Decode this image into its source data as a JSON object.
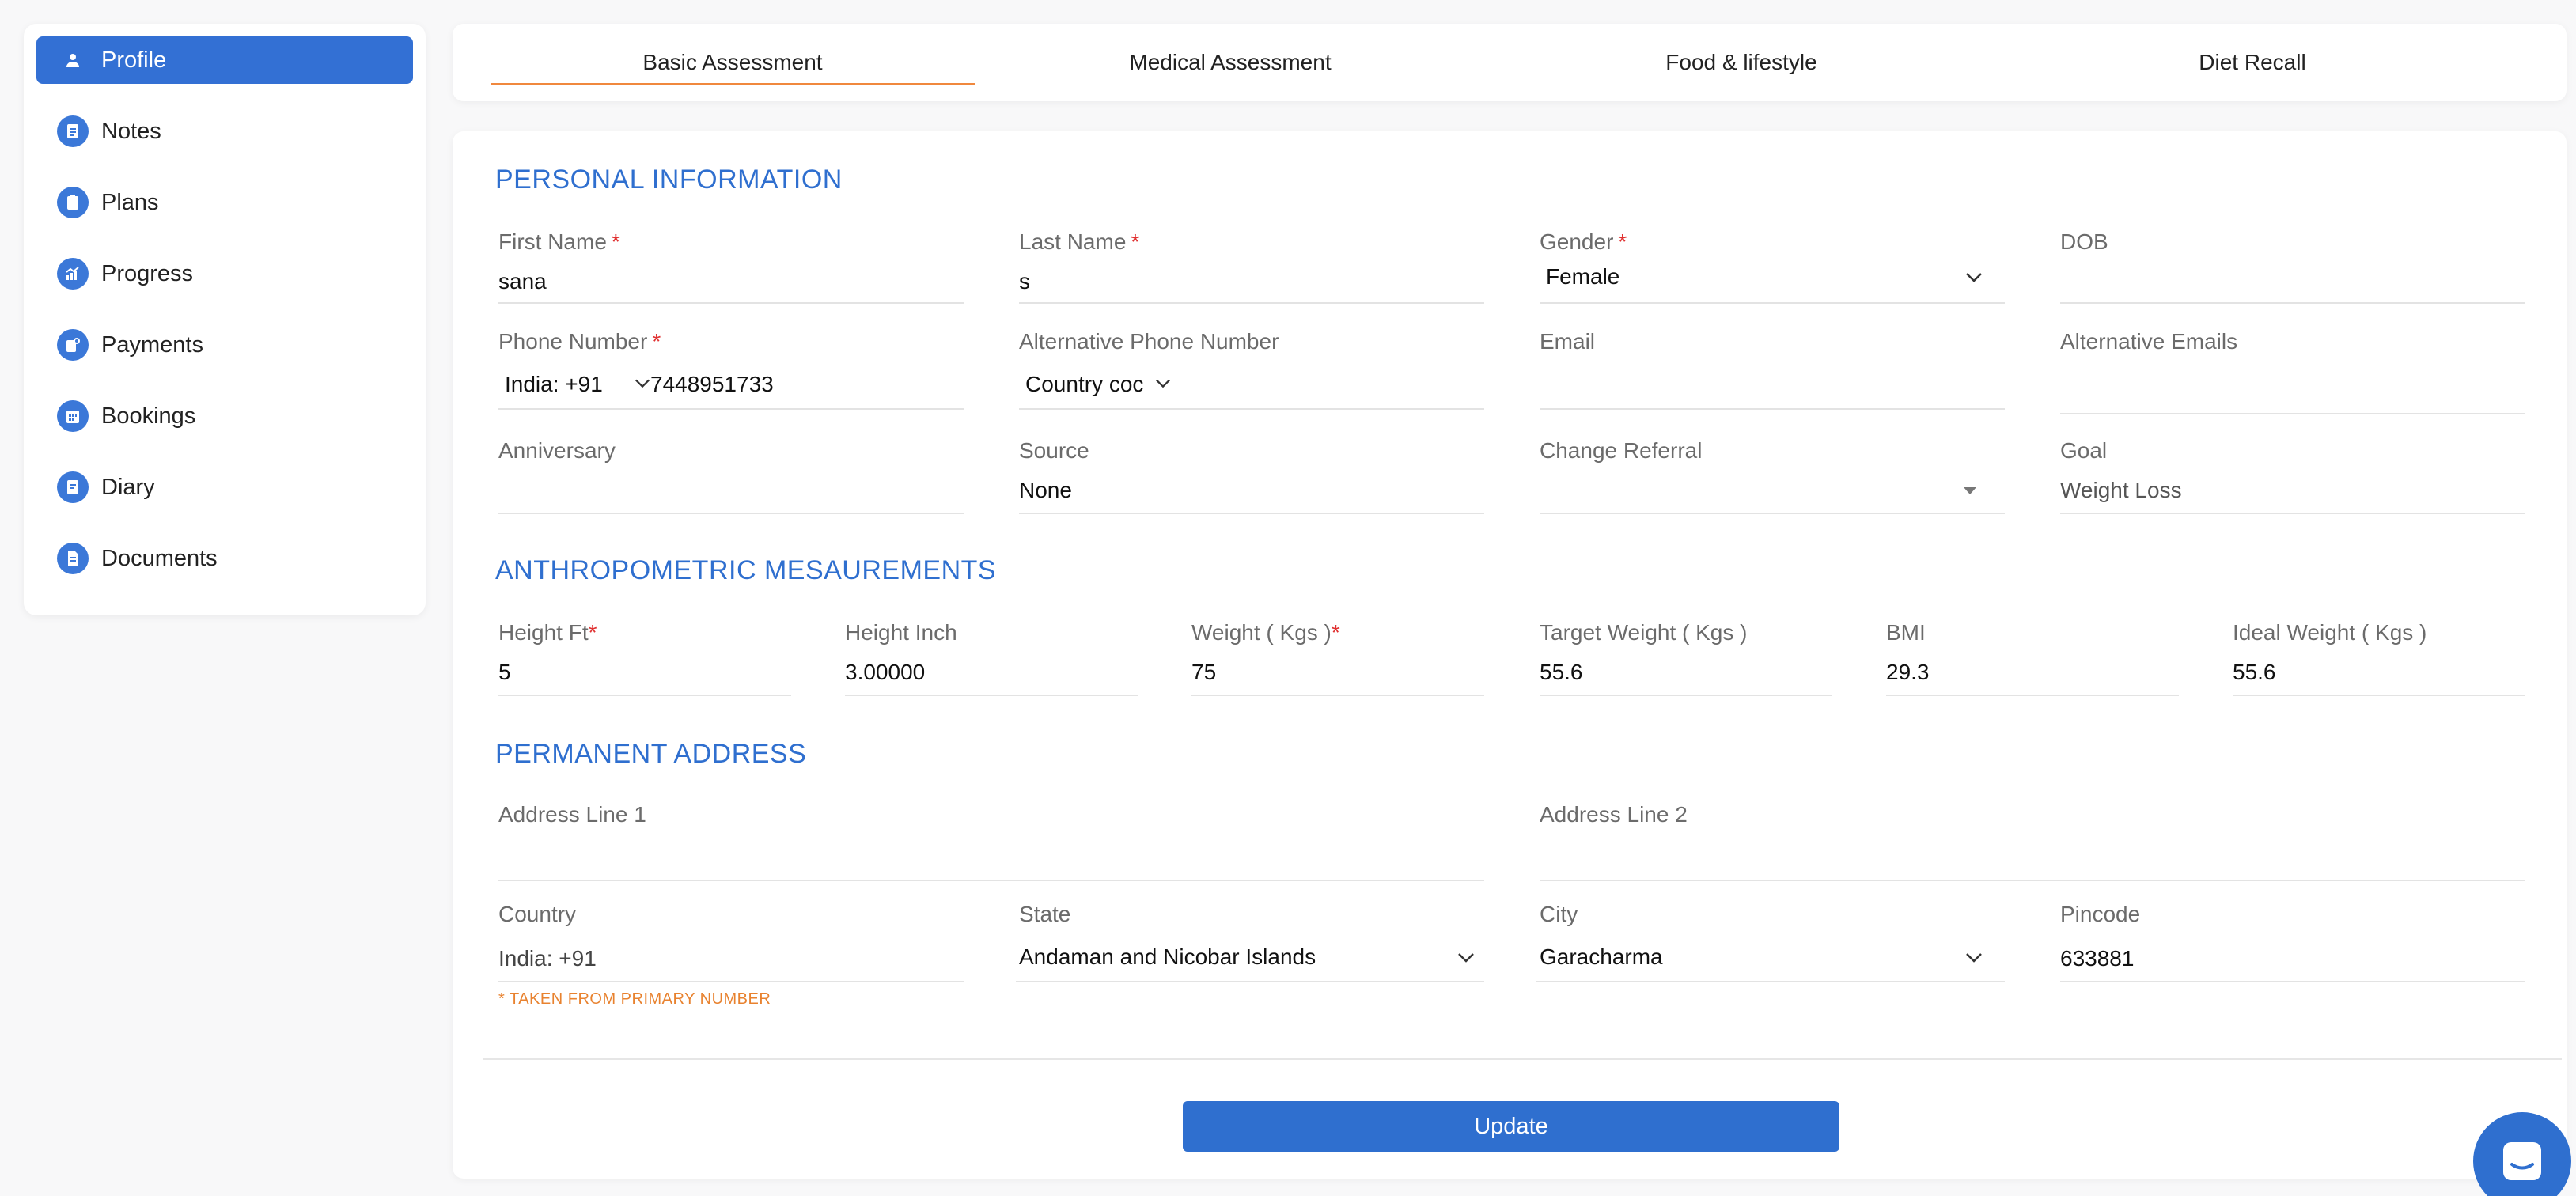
{
  "sidebar": {
    "items": [
      {
        "label": "Profile",
        "icon": "user-icon",
        "active": true
      },
      {
        "label": "Notes",
        "icon": "notes-icon"
      },
      {
        "label": "Plans",
        "icon": "plans-icon"
      },
      {
        "label": "Progress",
        "icon": "progress-icon"
      },
      {
        "label": "Payments",
        "icon": "payments-icon"
      },
      {
        "label": "Bookings",
        "icon": "bookings-icon"
      },
      {
        "label": "Diary",
        "icon": "diary-icon"
      },
      {
        "label": "Documents",
        "icon": "documents-icon"
      }
    ]
  },
  "tabs": [
    {
      "label": "Basic Assessment",
      "active": true
    },
    {
      "label": "Medical Assessment"
    },
    {
      "label": "Food & lifestyle"
    },
    {
      "label": "Diet Recall"
    }
  ],
  "personal": {
    "title": "PERSONAL INFORMATION",
    "first_name": {
      "label": "First Name",
      "value": "sana"
    },
    "last_name": {
      "label": "Last Name",
      "value": "s"
    },
    "gender": {
      "label": "Gender",
      "value": "Female"
    },
    "dob": {
      "label": "DOB",
      "value": ""
    },
    "phone": {
      "label": "Phone Number",
      "code": "India: +91",
      "value": "7448951733"
    },
    "alt_phone": {
      "label": "Alternative Phone Number",
      "code": "Country coc"
    },
    "email": {
      "label": "Email",
      "value": ""
    },
    "alt_emails": {
      "label": "Alternative Emails",
      "value": ""
    },
    "anniversary": {
      "label": "Anniversary",
      "value": ""
    },
    "source": {
      "label": "Source",
      "value": "None"
    },
    "referral": {
      "label": "Change Referral",
      "value": ""
    },
    "goal": {
      "label": "Goal",
      "value": "Weight Loss"
    }
  },
  "anthro": {
    "title": "ANTHROPOMETRIC MESAUREMENTS",
    "height_ft": {
      "label": "Height Ft",
      "value": "5"
    },
    "height_inch": {
      "label": "Height Inch",
      "value": "3.00000"
    },
    "weight": {
      "label": "Weight ( Kgs )",
      "value": "75"
    },
    "target_weight": {
      "label": "Target Weight ( Kgs )",
      "value": "55.6"
    },
    "bmi": {
      "label": "BMI",
      "value": "29.3"
    },
    "ideal_weight": {
      "label": "Ideal Weight ( Kgs )",
      "value": "55.6"
    }
  },
  "address": {
    "title": "PERMANENT ADDRESS",
    "line1": {
      "label": "Address Line 1",
      "value": ""
    },
    "line2": {
      "label": "Address Line 2",
      "value": ""
    },
    "country": {
      "label": "Country",
      "value": "India: +91",
      "hint": "* TAKEN FROM PRIMARY NUMBER"
    },
    "state": {
      "label": "State",
      "value": "Andaman and Nicobar Islands"
    },
    "city": {
      "label": "City",
      "value": "Garacharma"
    },
    "pincode": {
      "label": "Pincode",
      "value": "633881"
    }
  },
  "actions": {
    "update_label": "Update"
  },
  "colors": {
    "accent": "#2f6fcf",
    "tab_underline": "#f0883e",
    "required": "#e03030",
    "hint": "#e8822f"
  }
}
